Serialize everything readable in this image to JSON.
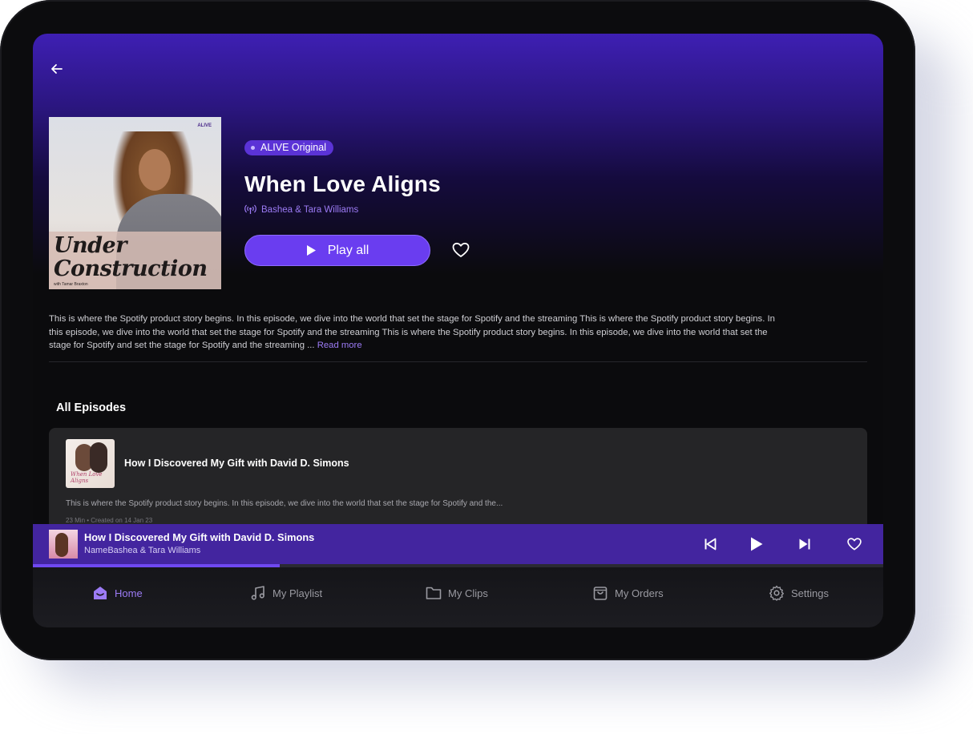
{
  "header": {
    "back_icon": "arrow-left-icon"
  },
  "show": {
    "cover": {
      "title_line1": "Under",
      "title_line2": "Construction",
      "subtitle": "with Tamar Braxton",
      "logo_text": "ALIVE"
    },
    "badge": "ALIVE Original",
    "title": "When Love Aligns",
    "author": "Bashea & Tara Williams",
    "author_icon": "broadcast-icon",
    "play_all_label": "Play all",
    "favorite_icon": "heart-icon",
    "description": "This is where the Spotify product story begins. In this episode, we dive into the world that set the stage for Spotify and the streaming This is where the Spotify product story begins. In this episode, we dive into the world that set the stage for Spotify and the streaming This is where the Spotify product story begins. In this episode, we dive into the world that set the stage for Spotify and set the stage for Spotify and the streaming ...",
    "read_more": "Read more"
  },
  "episodes": {
    "section_title": "All Episodes",
    "items": [
      {
        "title": "How I Discovered My Gift with David D. Simons",
        "description": "This is where the Spotify product story begins. In this episode, we dive into the world that set the stage for Spotify and the...",
        "meta": "23 Min • Created on 14 Jan 23",
        "thumb_text": "When Love Aligns"
      }
    ]
  },
  "player": {
    "title": "How I Discovered My Gift with David D. Simons",
    "artist": "NameBashea & Tara Williams",
    "progress": 0.29,
    "controls": [
      "skip-previous-icon",
      "play-icon",
      "skip-next-icon",
      "heart-icon"
    ]
  },
  "nav": {
    "items": [
      {
        "label": "Home",
        "icon": "home-icon",
        "active": true
      },
      {
        "label": "My Playlist",
        "icon": "music-note-icon",
        "active": false
      },
      {
        "label": "My Clips",
        "icon": "folder-icon",
        "active": false
      },
      {
        "label": "My Orders",
        "icon": "shopping-bag-icon",
        "active": false
      },
      {
        "label": "Settings",
        "icon": "gear-icon",
        "active": false
      }
    ]
  },
  "colors": {
    "accent": "#6a3df0",
    "accent_text": "#9c7bf5",
    "player_bg": "#43259f",
    "background": "#0b0b0d"
  }
}
